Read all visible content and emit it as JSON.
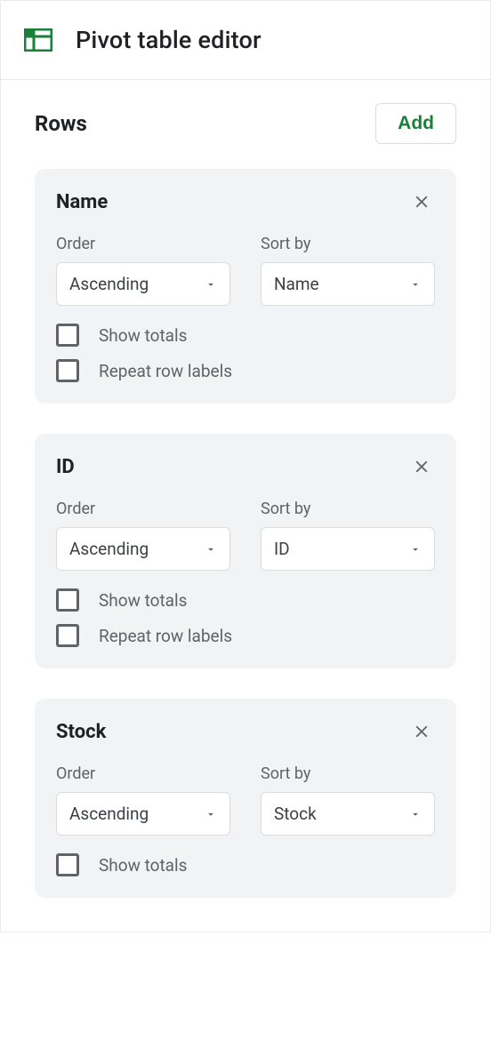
{
  "header": {
    "title": "Pivot table editor"
  },
  "rows_section": {
    "title": "Rows",
    "add_label": "Add"
  },
  "labels": {
    "order": "Order",
    "sort_by": "Sort by",
    "show_totals": "Show totals",
    "repeat_row_labels": "Repeat row labels"
  },
  "row_cards": [
    {
      "title": "Name",
      "order_value": "Ascending",
      "sort_by_value": "Name",
      "show_totals_checked": false,
      "has_repeat_labels": true,
      "repeat_labels_checked": false
    },
    {
      "title": "ID",
      "order_value": "Ascending",
      "sort_by_value": "ID",
      "show_totals_checked": false,
      "has_repeat_labels": true,
      "repeat_labels_checked": false
    },
    {
      "title": "Stock",
      "order_value": "Ascending",
      "sort_by_value": "Stock",
      "show_totals_checked": false,
      "has_repeat_labels": false
    }
  ],
  "colors": {
    "accent_green": "#188038",
    "text_secondary": "#5f6368",
    "card_bg": "#f1f3f4"
  }
}
